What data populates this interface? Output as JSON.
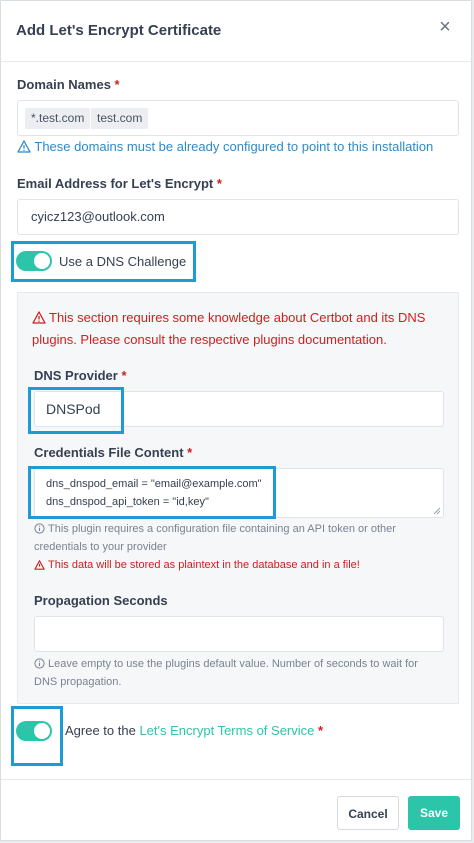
{
  "modal": {
    "title": "Add Let's Encrypt Certificate",
    "close_glyph": "×"
  },
  "domain_names": {
    "label": "Domain Names",
    "required_mark": "*",
    "tags": [
      "*.test.com",
      "test.com"
    ],
    "hint": "These domains must be already configured to point to this installation"
  },
  "email": {
    "label": "Email Address for Let's Encrypt",
    "required_mark": "*",
    "value": "cyicz123@outlook.com"
  },
  "dns_challenge": {
    "label": "Use a DNS Challenge",
    "enabled": true
  },
  "dns_panel": {
    "warning": "This section requires some knowledge about Certbot and its DNS plugins. Please consult the respective plugins documentation.",
    "provider_label": "DNS Provider",
    "provider_required": "*",
    "provider_value": "DNSPod",
    "credentials_label": "Credentials File Content",
    "credentials_required": "*",
    "credentials_line1": "dns_dnspod_email = \"email@example.com\"",
    "credentials_line2": "dns_dnspod_api_token = \"id,key\"",
    "credentials_help": "This plugin requires a configuration file containing an API token or other credentials to your provider",
    "credentials_warning": "This data will be stored as plaintext in the database and in a file!",
    "propagation_label": "Propagation Seconds",
    "propagation_value": "",
    "propagation_help": "Leave empty to use the plugins default value. Number of seconds to wait for DNS propagation."
  },
  "terms": {
    "enabled": true,
    "prefix": "Agree to the ",
    "link_text": "Let's Encrypt Terms of Service",
    "required_mark": "*"
  },
  "footer": {
    "cancel_label": "Cancel",
    "save_label": "Save"
  },
  "colors": {
    "accent": "#2cc5a9",
    "danger": "#cd201f",
    "info": "#2d8ac9",
    "highlight": "#1e9bd6"
  },
  "icons": {
    "info_hint": "alert-triangle-icon",
    "warning": "alert-triangle-icon",
    "help": "info-circle-icon",
    "close": "close-icon"
  }
}
